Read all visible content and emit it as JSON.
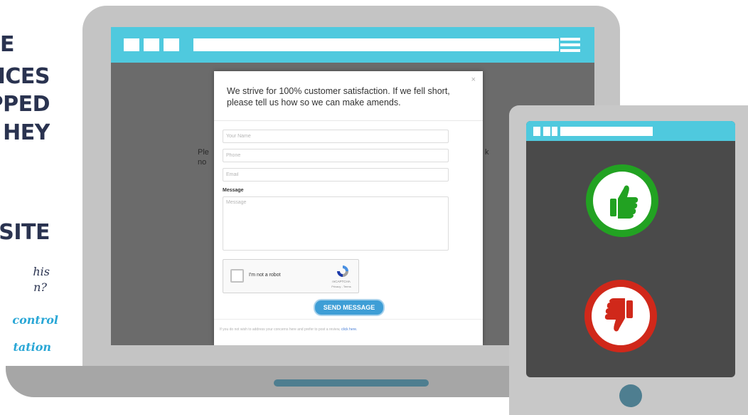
{
  "headline_lines": [
    "E",
    "ICES",
    "PPED",
    "HEY",
    "SITE"
  ],
  "subtext": {
    "line1": "his",
    "line2": "n?",
    "link1": "control",
    "link2": "tation"
  },
  "background_page": {
    "left_text_1": "Ple",
    "left_text_2": "no",
    "right_text": "k"
  },
  "modal": {
    "close_label": "×",
    "heading": "We strive for 100% customer satisfaction. If we fell short, please tell us how so we can make amends.",
    "name_placeholder": "Your Name",
    "phone_placeholder": "Phone",
    "email_placeholder": "Email",
    "message_label": "Message",
    "message_placeholder": "Message",
    "captcha_label": "I'm not a robot",
    "captcha_brand": "reCAPTCHA",
    "captcha_terms": "Privacy - Terms",
    "send_label": "SEND MESSAGE",
    "footer_text": "If you do not wish to address your concerns here and prefer to post a review,",
    "footer_link": "click here."
  },
  "colors": {
    "accent_cyan": "#4fc9de",
    "send_button": "#3e9ed6",
    "thumbs_up": "#22a222",
    "thumbs_down": "#d0281a",
    "headline_navy": "#2a3350",
    "link_cyan": "#2aa7d6"
  },
  "icons": [
    "hamburger-menu-icon",
    "close-icon",
    "recaptcha-icon",
    "thumbs-up-icon",
    "thumbs-down-icon"
  ]
}
